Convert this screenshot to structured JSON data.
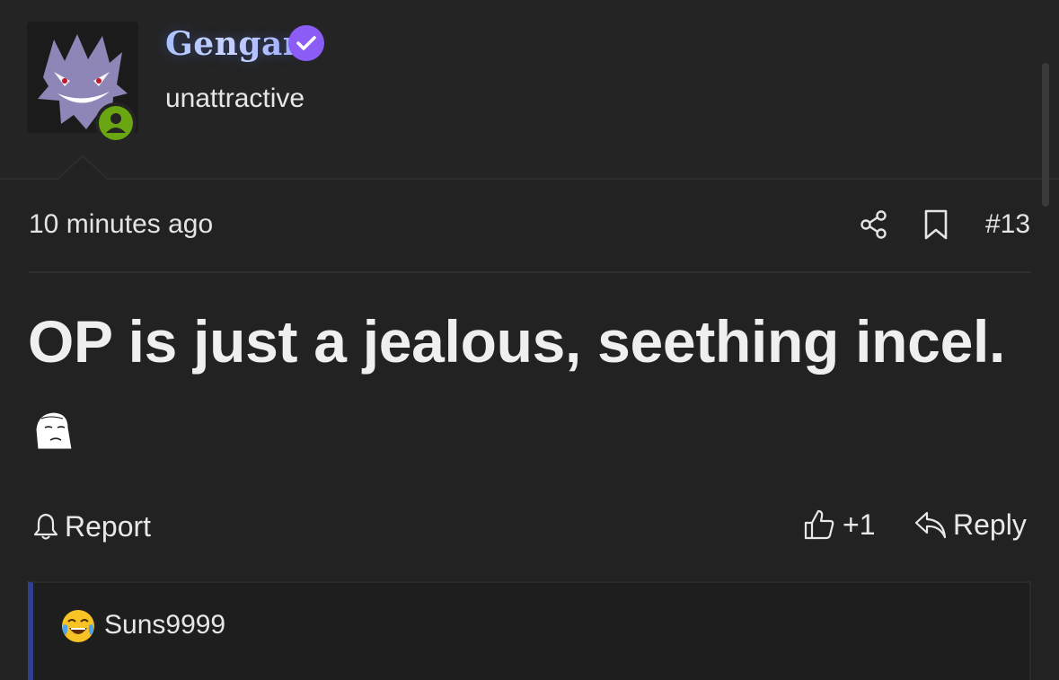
{
  "post": {
    "author": {
      "username": "Gengar",
      "title": "unattractive",
      "verified": true,
      "online": true,
      "avatar_icon": "gengar-avatar"
    },
    "timestamp": "10 minutes ago",
    "number": "#13",
    "body": "OP is just a jealous, seething incel.",
    "actions": {
      "report": "Report",
      "like_count": "+1",
      "reply": "Reply"
    }
  },
  "quote": {
    "emoji_icon": "crying-laughing-emoji",
    "author": "Suns9999"
  },
  "colors": {
    "background": "#222222",
    "header_bg": "#242424",
    "verified_badge": "#8b5cf6",
    "online_badge": "#6aa512",
    "quote_accent": "#2f3f8f"
  }
}
